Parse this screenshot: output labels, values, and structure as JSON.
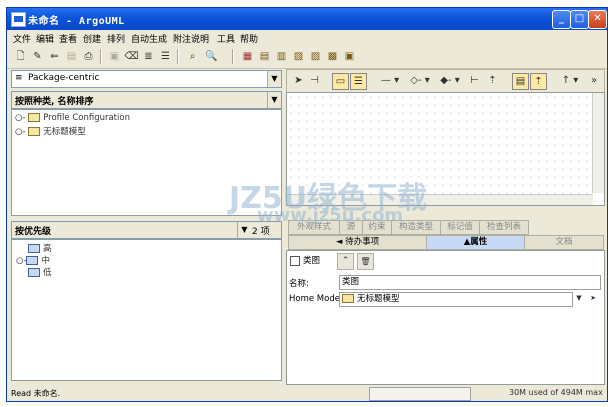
{
  "window": {
    "title": "未命名 - ArgoUML"
  },
  "menu": [
    "文件",
    "编辑",
    "查看",
    "创建",
    "排列",
    "自动生成",
    "附注说明",
    "工具",
    "帮助"
  ],
  "toolbar": {
    "icons": [
      "new-file-icon",
      "open-file-icon",
      "save-icon",
      "save-as-icon",
      "print-icon",
      "delete-disabled-icon",
      "delete-icon",
      "copy-icon",
      "paste-icon",
      "find-icon",
      "zoom-icon",
      "class-diagram-icon",
      "usecase-diagram-icon",
      "state-diagram-icon",
      "activity-diagram-icon",
      "collaboration-diagram-icon",
      "deployment-diagram-icon",
      "sequence-diagram-icon"
    ]
  },
  "explorer": {
    "perspective": "Package-centric",
    "order": "按照种类, 名称排序",
    "tree": [
      {
        "label": "Profile Configuration"
      },
      {
        "label": "无标题模型"
      }
    ]
  },
  "todo": {
    "order": "按优先级",
    "count": "2 项",
    "items": [
      "高",
      "中",
      "低"
    ]
  },
  "details": {
    "upper_tabs": [
      "外观样式",
      "源",
      "约束",
      "构造类型",
      "标记值",
      "检查列表"
    ],
    "lower_tabs": [
      "◄ 待办事项",
      "▲属性",
      "文档"
    ],
    "header": "类图",
    "name_label": "名称:",
    "name_value": "类图",
    "home_model_label": "Home Model:",
    "home_model_value": "无标题模型"
  },
  "status": {
    "left": "Read 未命名.",
    "memory": "30M used of 494M max"
  },
  "watermark": {
    "text1": "JZ5U绿色下载",
    "text2": "www.jz5u.com"
  },
  "glyphs": {
    "min": "_",
    "max": "□",
    "close": "✕",
    "dropdown": "▼",
    "expand": "○-",
    "up": "⌃",
    "trash": "🗑",
    "select": "➤",
    "ellipsis": "»"
  }
}
